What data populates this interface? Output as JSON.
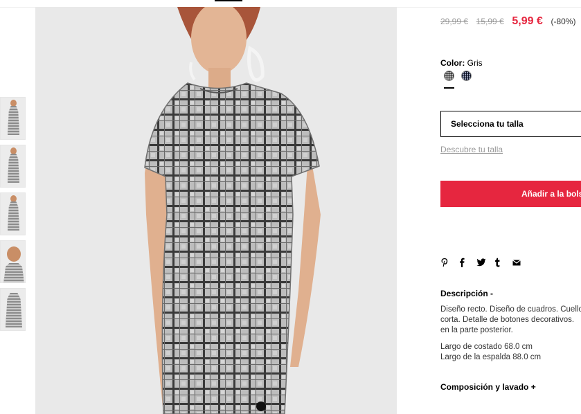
{
  "thumbnails": [
    {
      "alt": "thumb-1"
    },
    {
      "alt": "thumb-2"
    },
    {
      "alt": "thumb-3"
    },
    {
      "alt": "thumb-4"
    },
    {
      "alt": "thumb-5"
    }
  ],
  "product": {
    "price_original": "29,99 €",
    "price_previous": "15,99 €",
    "price_sale": "5,99 €",
    "discount": "(-80%)",
    "color_label": "Color:",
    "color_value": "Gris",
    "size_select": "Selecciona tu talla",
    "size_guide": "Descubre tu talla",
    "add_to_bag": "Añadir a la bolsa",
    "description_title": "Descripción  -",
    "description_lines": [
      "Diseño recto. Diseño de cuadros. Cuello",
      "corta. Detalle de botones decorativos.",
      "en la parte posterior."
    ],
    "measure_lines": [
      "Largo de costado 68.0 cm",
      "Largo de la espalda 88.0 cm"
    ],
    "composition_title": "Composición y lavado  +"
  },
  "share_icons": [
    "pinterest-icon",
    "facebook-icon",
    "twitter-icon",
    "tumblr-icon",
    "mail-icon"
  ],
  "colors": {
    "sale": "#e6263f",
    "strike": "#999999",
    "button": "#e6263f"
  }
}
